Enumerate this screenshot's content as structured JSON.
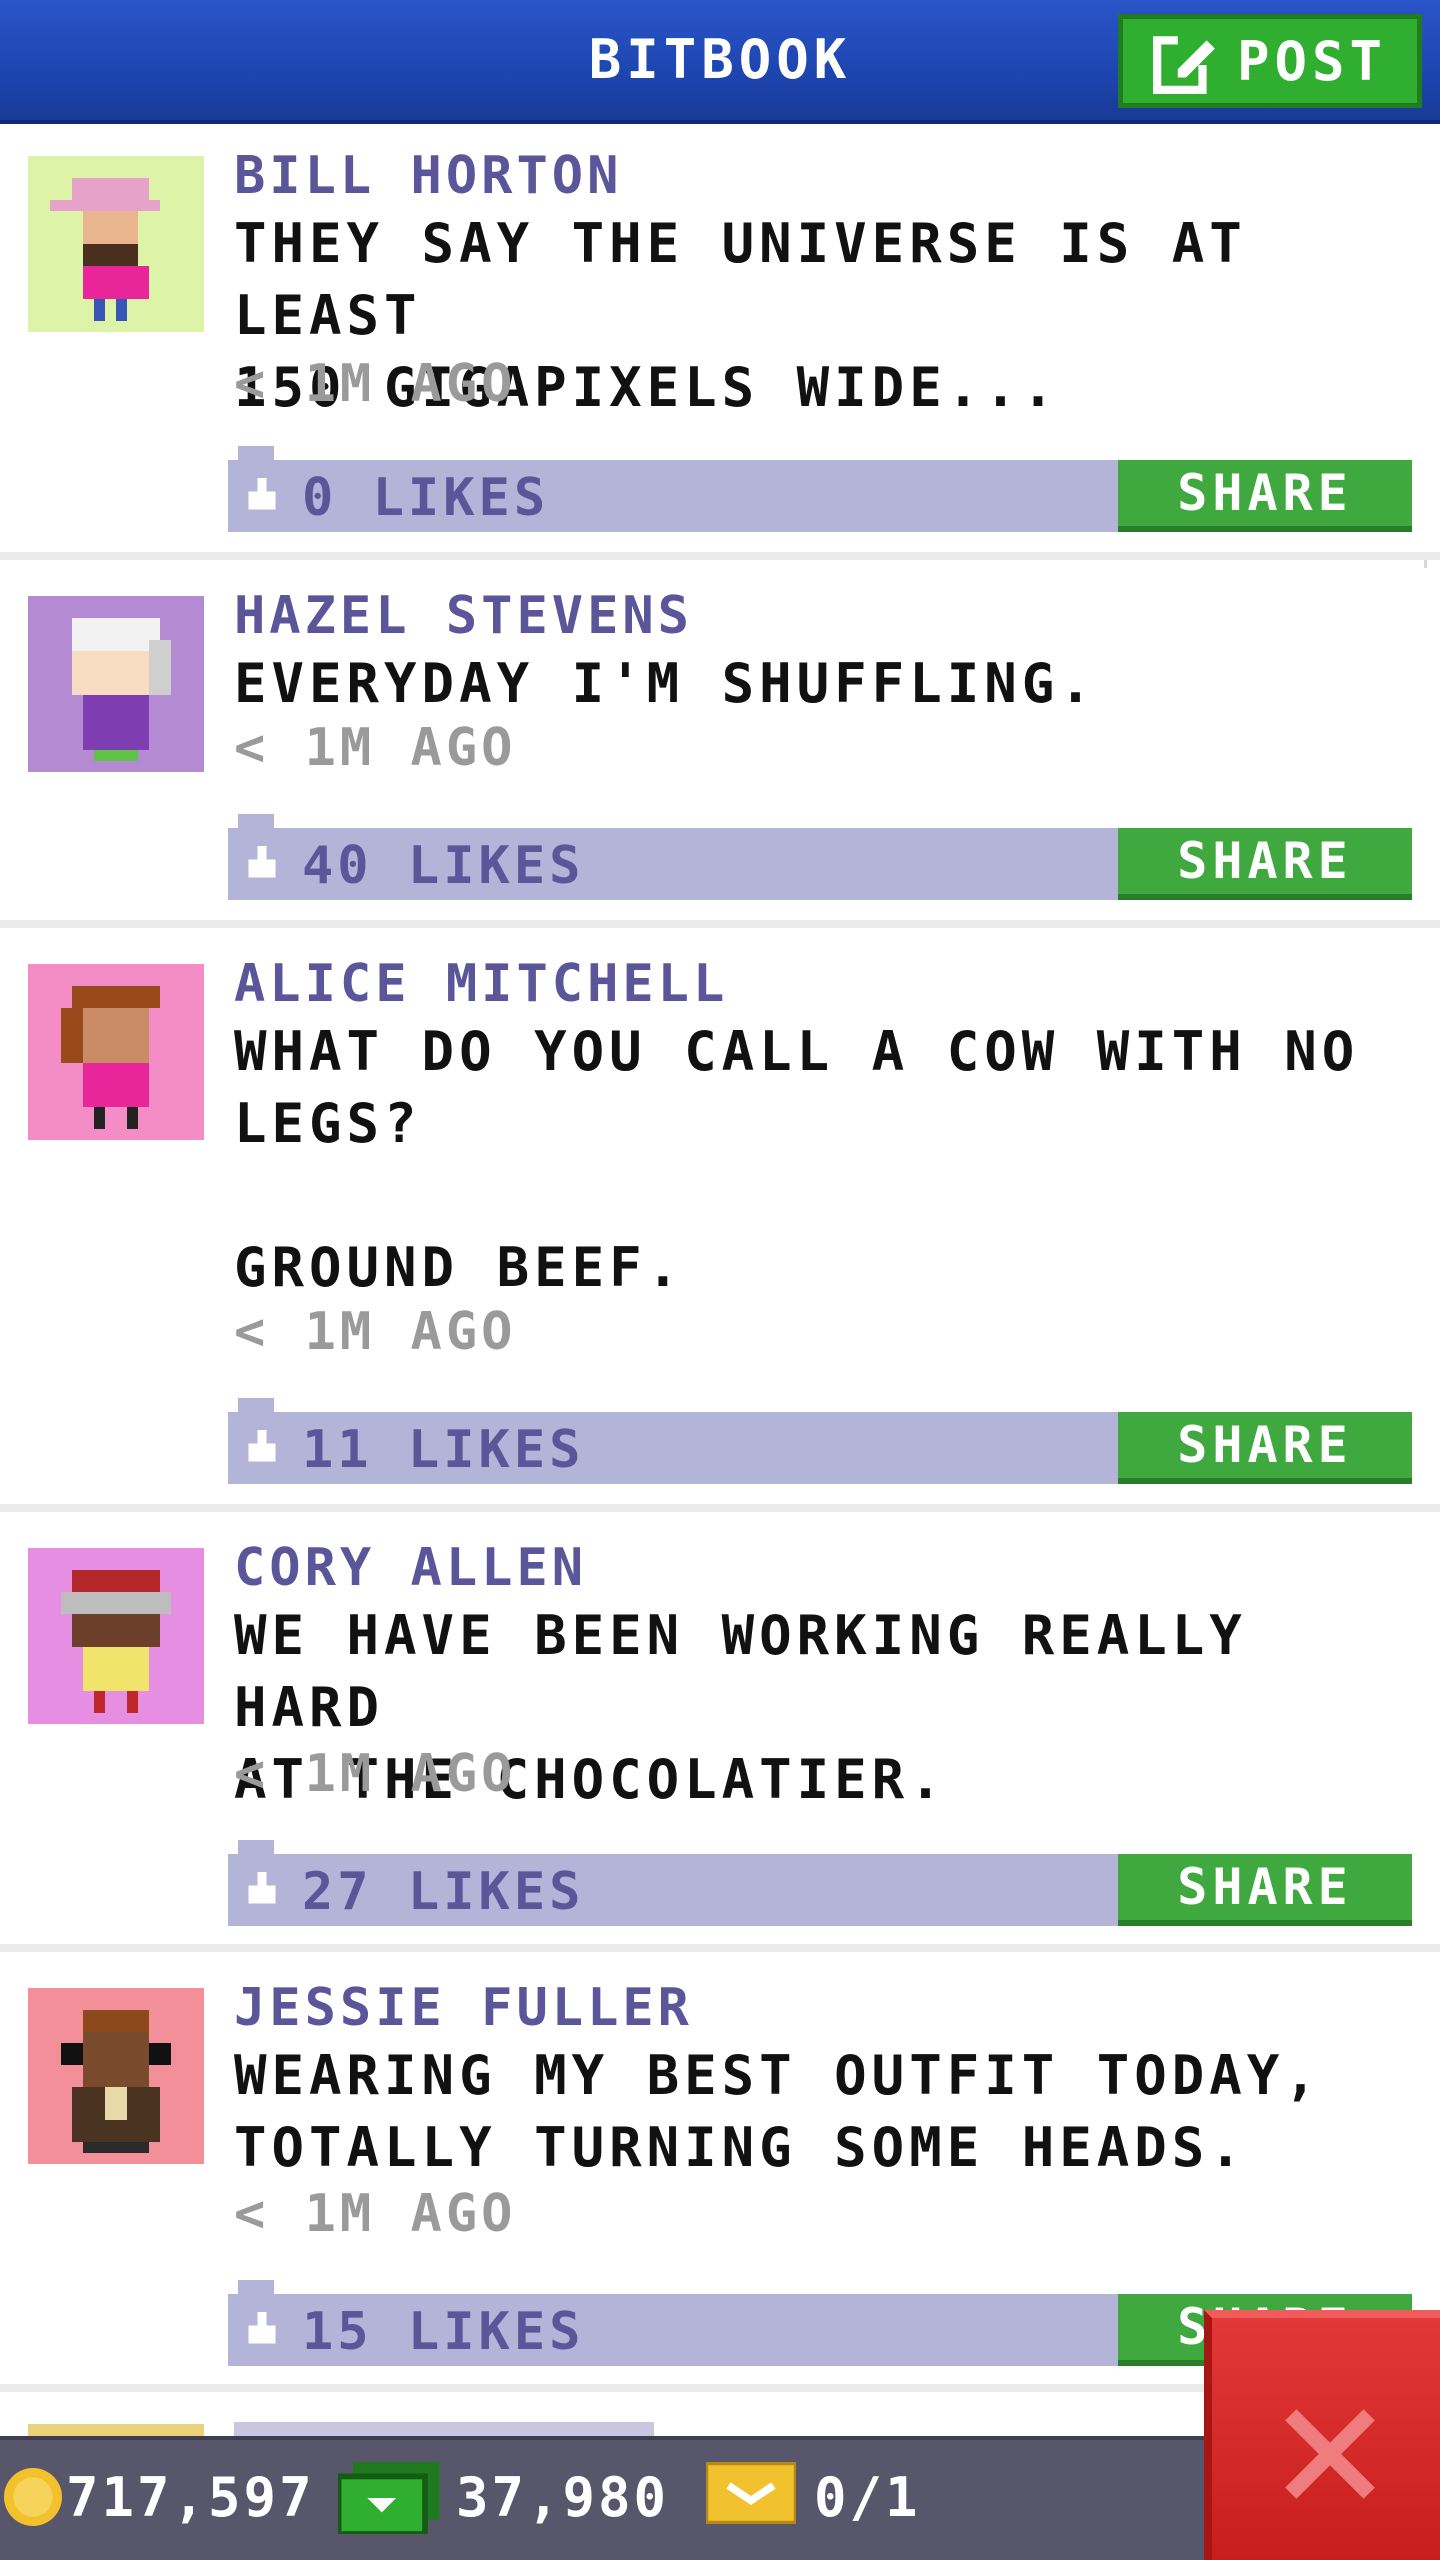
{
  "header": {
    "title": "BITBOOK",
    "post_label": "POST"
  },
  "posts": [
    {
      "author": "BILL HORTON",
      "message": "THEY SAY THE UNIVERSE IS AT LEAST\n150 GIGAPIXELS WIDE...",
      "time": "< 1M AGO",
      "likes": "0 LIKES",
      "share": "SHARE",
      "avatar_bg": "#ddf3a8"
    },
    {
      "author": "HAZEL STEVENS",
      "message": "EVERYDAY I'M SHUFFLING.",
      "time": "< 1M AGO",
      "likes": "40 LIKES",
      "share": "SHARE",
      "avatar_bg": "#b48bd2"
    },
    {
      "author": "ALICE MITCHELL",
      "message": "WHAT DO YOU CALL A COW WITH NO\nLEGS?\n\nGROUND BEEF.",
      "time": "< 1M AGO",
      "likes": "11 LIKES",
      "share": "SHARE",
      "avatar_bg": "#f48dc6"
    },
    {
      "author": "CORY ALLEN",
      "message": "WE HAVE BEEN WORKING REALLY HARD\nAT THE CHOCOLATIER.",
      "time": "< 1M AGO",
      "likes": "27 LIKES",
      "share": "SHARE",
      "avatar_bg": "#e58ee2"
    },
    {
      "author": "JESSIE FULLER",
      "message": "WEARING MY BEST OUTFIT TODAY,\nTOTALLY TURNING SOME HEADS.",
      "time": "< 1M AGO",
      "likes": "15 LIKES",
      "share": "SHARE",
      "avatar_bg": "#f38f98"
    }
  ],
  "status_bar": {
    "coins": "717,597",
    "bux": "37,980",
    "tickets": "0/1"
  },
  "colors": {
    "header": "#1e46b0",
    "accent_green": "#3fa93f",
    "author": "#5b5699",
    "like_bar": "#b3b4d8",
    "close_red": "#d42525"
  },
  "icons": [
    "post-edit-icon",
    "like-icon",
    "coin-icon",
    "bux-icon",
    "ticket-icon",
    "close-icon"
  ]
}
